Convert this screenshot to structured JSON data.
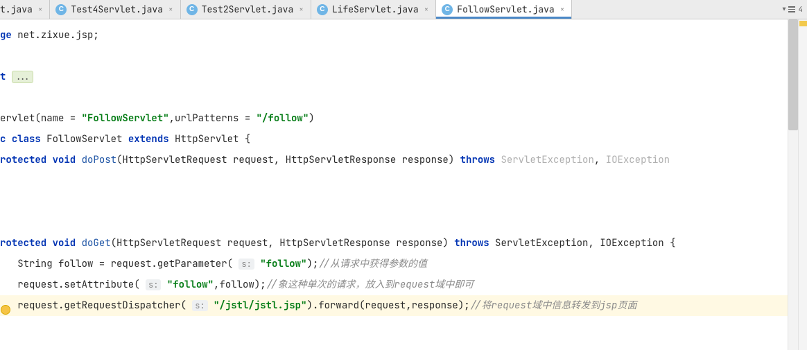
{
  "tabs": [
    {
      "label": "t.java",
      "partial": true,
      "icon": false,
      "active": false
    },
    {
      "label": "Test4Servlet.java",
      "partial": false,
      "icon": true,
      "active": false
    },
    {
      "label": "Test2Servlet.java",
      "partial": false,
      "icon": true,
      "active": false
    },
    {
      "label": "LifeServlet.java",
      "partial": false,
      "icon": true,
      "active": false
    },
    {
      "label": "FollowServlet.java",
      "partial": false,
      "icon": true,
      "active": true
    }
  ],
  "tabbar_buttons": {
    "count_label": "4"
  },
  "code": {
    "pkg_kw": "ge",
    "pkg_path": "net.zixue.jsp",
    "import_kw": "t",
    "fold": "...",
    "anno_pre": "ervlet",
    "anno_name_attr": "name = ",
    "servlet_name": "\"FollowServlet\"",
    "anno_url_attr": ",urlPatterns = ",
    "url_pattern": "\"/follow\"",
    "cls_mod": "c",
    "cls_kw": "class",
    "cls_name": "FollowServlet",
    "ext_kw": "extends",
    "super_cls": "HttpServlet",
    "open_brace": "{",
    "prot_kw": "rotected",
    "void_kw": "void",
    "m_doPost": "doPost",
    "m_doGet": "doGet",
    "sig_params": "(HttpServletRequest request, HttpServletResponse response)",
    "throws_kw": "throws",
    "exc1": "ServletException",
    "exc2": "IOException",
    "open_brace2": "{",
    "l_string": "String follow = request.getParameter(",
    "p_hint": "s:",
    "arg_follow": "\"follow\"",
    "tail_getparam": ");",
    "cmt_getparam": "//从请求中获得参数的值",
    "l_setattr_head": "request.setAttribute(",
    "setattr_tail": ",follow);",
    "cmt_setattr": "//象这种单次的请求，放入到request域中即可",
    "l_dispatch_head": "request.getRequestDispatcher(",
    "jstl_path": "\"/jstl/jstl.jsp\"",
    "dispatch_tail": ").forward(request,response);",
    "cmt_dispatch": "//将request域中信息转发到jsp页面"
  }
}
